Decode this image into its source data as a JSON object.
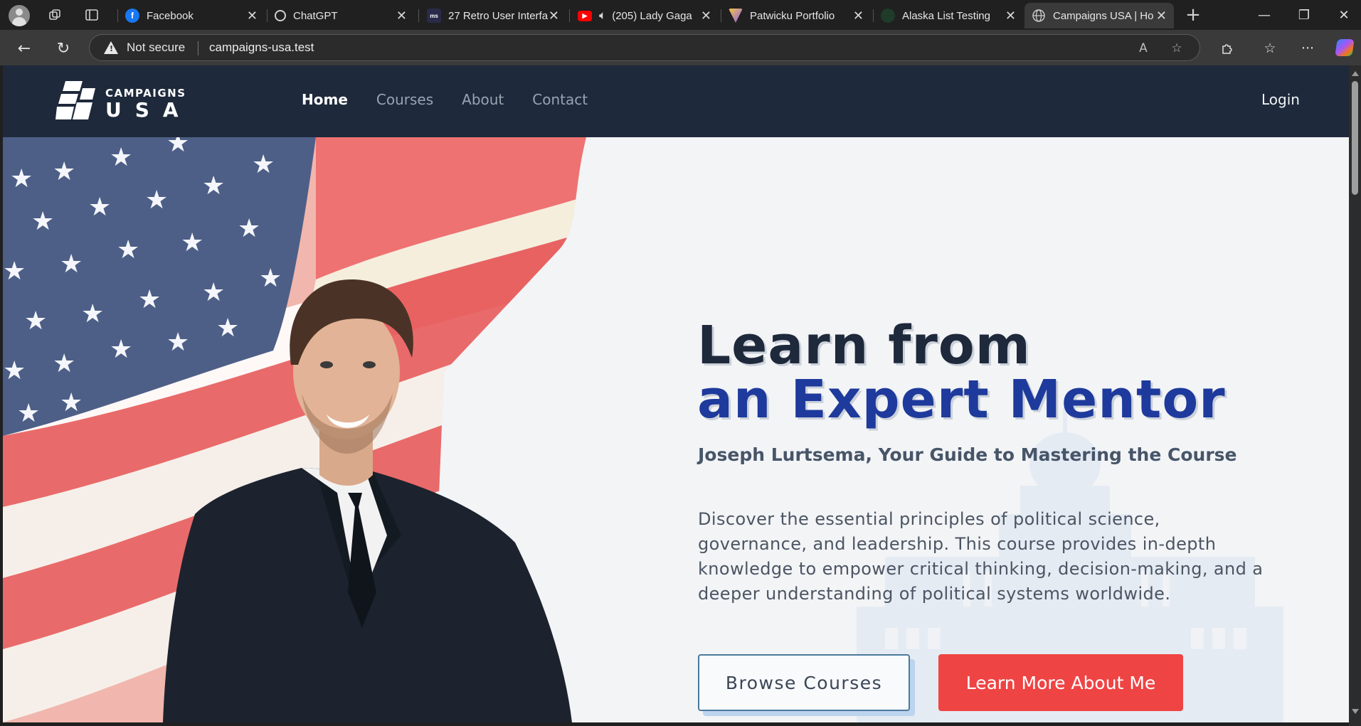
{
  "browser": {
    "tabs": [
      {
        "title": "Facebook",
        "icon": "facebook-icon",
        "color": "#1877f2"
      },
      {
        "title": "ChatGPT",
        "icon": "chatgpt-icon",
        "color": "#e0e0e0"
      },
      {
        "title": "27 Retro User Interfa",
        "icon": "retro-ui-icon",
        "color": "#2a2a4a"
      },
      {
        "title": "(205) Lady Gaga",
        "icon": "youtube-icon",
        "color": "#ff0000"
      },
      {
        "title": "Patwicku Portfolio",
        "icon": "portfolio-icon",
        "color": "#f5c542"
      },
      {
        "title": "Alaska List Testing",
        "icon": "alaska-icon",
        "color": "#2d5a3d"
      },
      {
        "title": "Campaigns USA | Ho",
        "icon": "globe-icon",
        "color": "#9aa0a6"
      }
    ],
    "security_label": "Not secure",
    "url": "campaigns-usa.test"
  },
  "site": {
    "logo": {
      "line1": "CAMPAIGNS",
      "line2": "USA"
    },
    "nav": [
      "Home",
      "Courses",
      "About",
      "Contact"
    ],
    "active_nav": "Home",
    "login": "Login"
  },
  "hero": {
    "headline_line1": "Learn from",
    "headline_line2": "an Expert Mentor",
    "subheadline": "Joseph Lurtsema, Your Guide to Mastering the Course",
    "description": "Discover the essential principles of political science, governance, and leadership. This course provides in-depth knowledge to empower critical thinking, decision-making, and a deeper understanding of political systems worldwide.",
    "primary_button": "Browse Courses",
    "secondary_button": "Learn More About Me"
  },
  "colors": {
    "header_bg": "#1e293b",
    "accent_blue": "#1e3a9c",
    "accent_red": "#ef4444",
    "page_bg": "#f3f4f6"
  }
}
